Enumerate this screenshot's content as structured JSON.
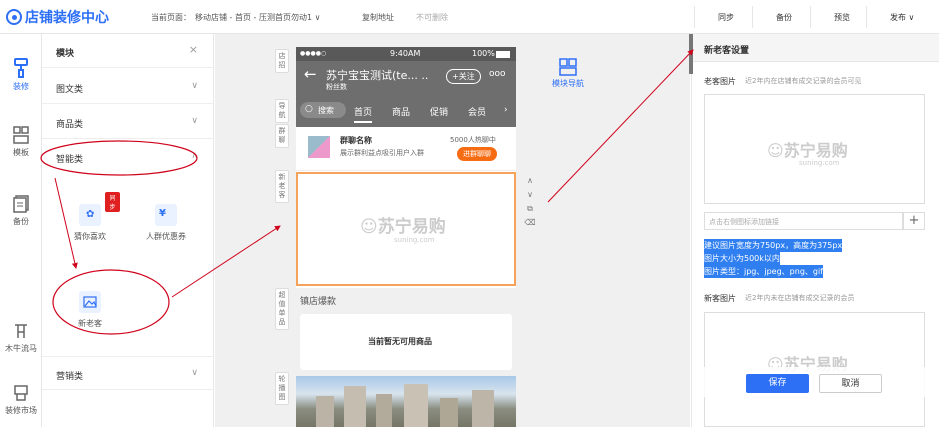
{
  "header": {
    "logo": "店铺装修中心",
    "current_label": "当前页面：",
    "breadcrumb": "移动店铺 - 首页 - 压测首页勿动1",
    "copy": "复制地址",
    "delete": "不可删除",
    "sync": "同步",
    "backup": "备份",
    "preview": "预览",
    "publish": "发布"
  },
  "leftnav": {
    "items": [
      {
        "label": "装修"
      },
      {
        "label": "模板"
      },
      {
        "label": "备份"
      },
      {
        "label": "木牛流马"
      },
      {
        "label": "装修市场"
      }
    ]
  },
  "panel": {
    "module_title": "模块",
    "close": "×",
    "categories": [
      {
        "label": "图文类"
      },
      {
        "label": "商品类"
      },
      {
        "label": "智能类"
      },
      {
        "label": "营销类"
      }
    ],
    "tools": [
      {
        "label": "猜你喜欢",
        "badge": "同步"
      },
      {
        "label": "人群优惠券"
      },
      {
        "label": "新老客"
      }
    ]
  },
  "canvas": {
    "side_tags": [
      "店招",
      "导航",
      "群聊",
      "新老客",
      "超值单品",
      "轮播图"
    ],
    "module_nav": "模块导航",
    "watermark": "苏宁易购",
    "watermark_sub": "suning.com"
  },
  "phone": {
    "status_time": "9:40AM",
    "status_battery": "100%",
    "carrier": "●●●●○",
    "shop_name": "苏宁宝宝测试(te... ..",
    "fans": "粉丝数",
    "follow": "+关注",
    "search": "搜索",
    "tabs": [
      "首页",
      "商品",
      "促销",
      "会员"
    ],
    "group_name": "群聊名称",
    "group_desc": "展示群利益点吸引用户入群",
    "group_count": "5000人热聊中",
    "group_btn": "进群聊聊",
    "hot_title": "镇店爆款",
    "no_goods": "当前暂无可用商品"
  },
  "settings": {
    "title": "新老客设置",
    "old_label": "老客图片",
    "old_hint": "近2年内在店铺有成交记录的会员可见",
    "link_placeholder": "点击右侧图标添加链接",
    "info": [
      "建议图片宽度为750px，高度为375px",
      "图片大小为500k以内",
      "图片类型：jpg、jpeg、png、gif"
    ],
    "new_label": "新客图片",
    "new_hint": "近2年内未在店铺有成交记录的会员",
    "save": "保存",
    "cancel": "取消"
  },
  "colors": {
    "accent": "#2d6ff5",
    "annotation": "#d0021b",
    "orange": "#f56c13"
  }
}
